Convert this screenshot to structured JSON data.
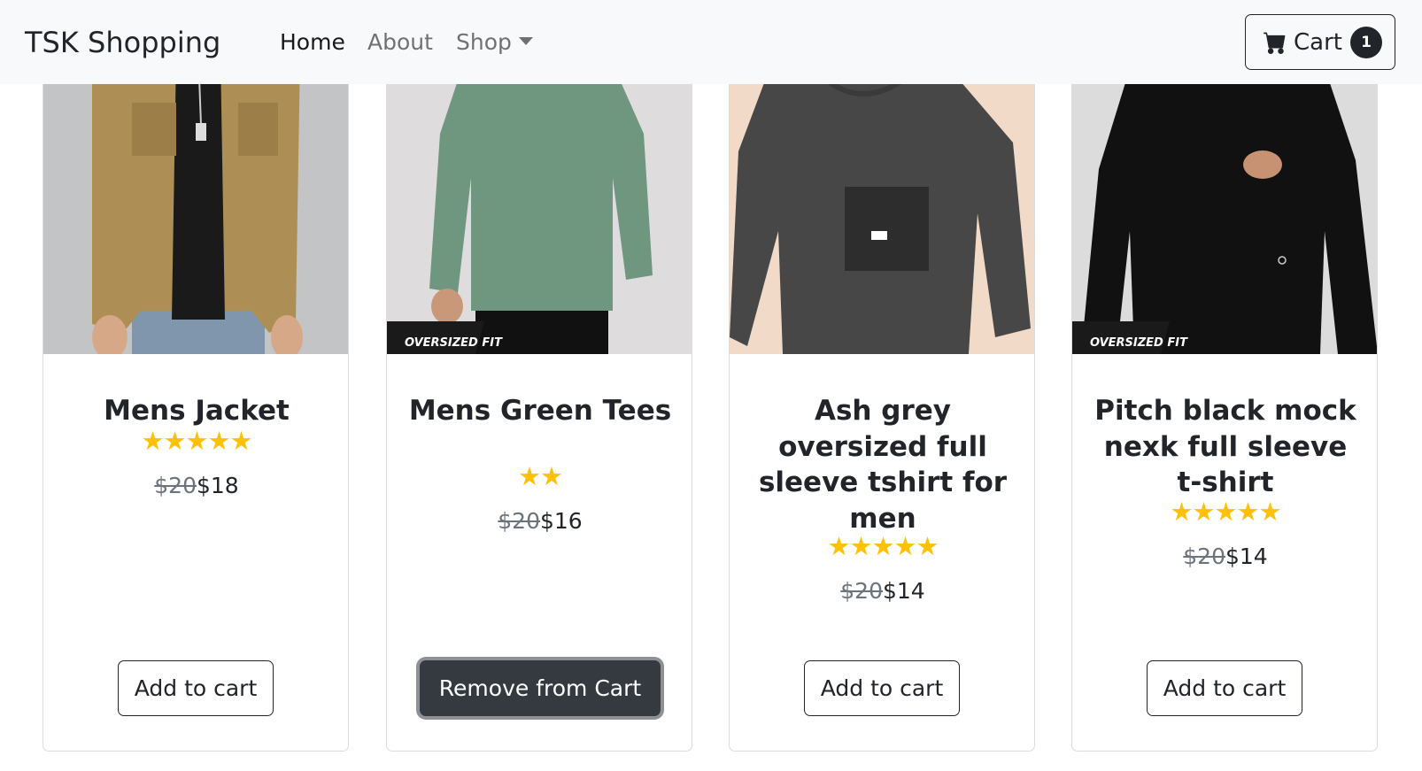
{
  "navbar": {
    "brand": "TSK Shopping",
    "links": [
      {
        "label": "Home"
      },
      {
        "label": "About"
      },
      {
        "label": "Shop"
      }
    ],
    "cart": {
      "label": "Cart",
      "count": "1",
      "icon": "cart-icon"
    }
  },
  "products": [
    {
      "title": "Mens Jacket",
      "rating": 5,
      "stars": "★★★★★",
      "old_price": "$20",
      "price": "$18",
      "button": "Add to cart",
      "image_badge": ""
    },
    {
      "title": "Mens Green Tees",
      "rating": 2,
      "stars": "★★",
      "old_price": "$20",
      "price": "$16",
      "button": "Remove from Cart",
      "image_badge": "OVERSIZED FIT"
    },
    {
      "title": "Ash grey oversized full sleeve tshirt for men",
      "rating": 5,
      "stars": "★★★★★",
      "old_price": "$20",
      "price": "$14",
      "button": "Add to cart",
      "image_badge": ""
    },
    {
      "title": "Pitch black mock nexk full sleeve t-shirt",
      "rating": 5,
      "stars": "★★★★★",
      "old_price": "$20",
      "price": "$14",
      "button": "Add to cart",
      "image_badge": "OVERSIZED FIT"
    }
  ],
  "colors": {
    "star": "#ffc107",
    "navbar_bg": "#f8f9fa",
    "dark_button": "#343a40"
  }
}
